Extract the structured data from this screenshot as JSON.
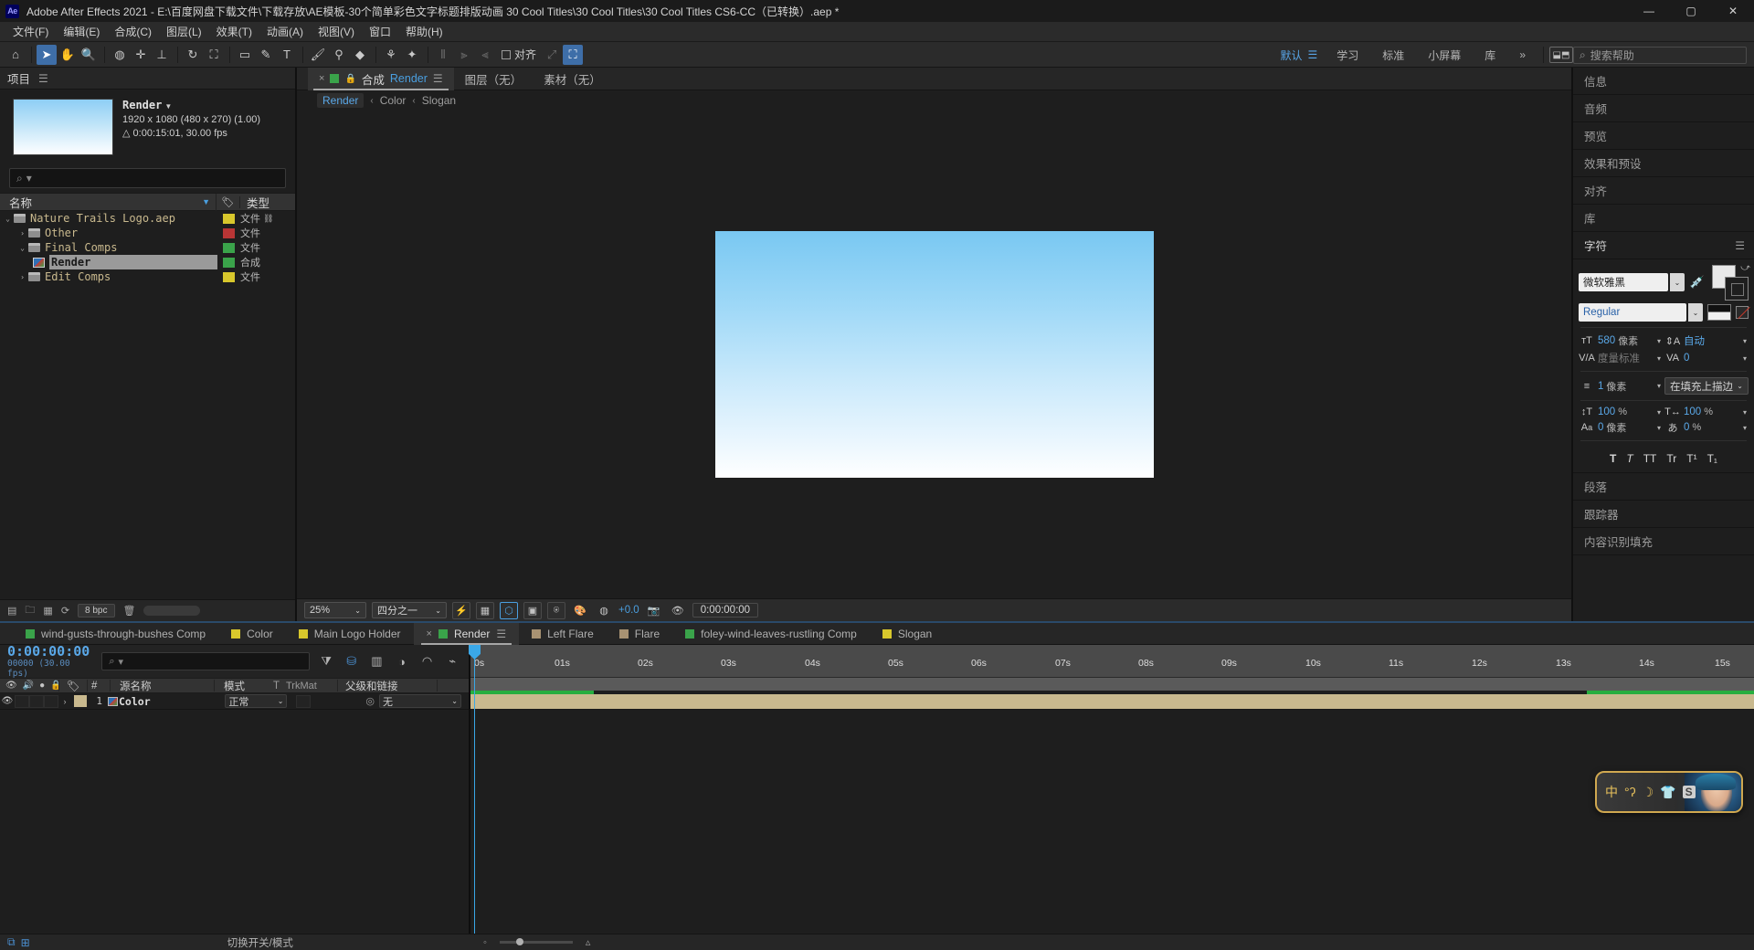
{
  "titlebar": {
    "app_icon": "Ae",
    "title": "Adobe After Effects 2021 - E:\\百度网盘下载文件\\下载存放\\AE模板-30个简单彩色文字标题排版动画 30 Cool Titles\\30 Cool Titles\\30 Cool Titles CS6-CC（已转换）.aep *",
    "minimize": "—",
    "maximize": "▢",
    "close": "✕"
  },
  "menubar": {
    "items": [
      "文件(F)",
      "编辑(E)",
      "合成(C)",
      "图层(L)",
      "效果(T)",
      "动画(A)",
      "视图(V)",
      "窗口",
      "帮助(H)"
    ]
  },
  "toolbar": {
    "align_label": "对齐",
    "workspaces": [
      "默认",
      "学习",
      "标准",
      "小屏幕",
      "库"
    ],
    "workspace_active": "默认",
    "overflow": "»",
    "search_placeholder": "搜索帮助"
  },
  "project": {
    "tab_label": "项目",
    "item_name": "Render",
    "item_dimensions": "1920 x 1080  (480 x 270) (1.00)",
    "item_duration": "0:00:15:01, 30.00 fps",
    "search_placeholder": "",
    "columns": {
      "name": "名称",
      "type": "类型"
    },
    "tree": [
      {
        "label": "Nature Trails Logo.aep",
        "type": "文件",
        "swatch": "#d8c72c",
        "indent": 0,
        "twist": "open",
        "icon": "folder",
        "selected": false,
        "has_extra": true
      },
      {
        "label": "Other",
        "type": "文件",
        "swatch": "#b83535",
        "indent": 1,
        "twist": "closed",
        "icon": "folder",
        "selected": false,
        "has_extra": false
      },
      {
        "label": "Final Comps",
        "type": "文件",
        "swatch": "#3aa34a",
        "indent": 1,
        "twist": "open",
        "icon": "folder",
        "selected": false,
        "has_extra": false
      },
      {
        "label": "Render",
        "type": "合成",
        "swatch": "#3aa34a",
        "indent": 2,
        "twist": "none",
        "icon": "comp",
        "selected": true,
        "has_extra": false
      },
      {
        "label": "Edit Comps",
        "type": "文件",
        "swatch": "#d8c72c",
        "indent": 1,
        "twist": "closed",
        "icon": "folder",
        "selected": false,
        "has_extra": false
      }
    ],
    "footer": {
      "bpc": "8 bpc"
    }
  },
  "comp": {
    "tab_comp_label": "合成",
    "tab_comp_name": "Render",
    "tab_layer": "图层（无）",
    "tab_footage": "素材（无）",
    "breadcrumb": [
      "Render",
      "Color",
      "Slogan"
    ],
    "breadcrumb_sep": "‹",
    "toolbar": {
      "zoom": "25%",
      "resolution": "四分之一",
      "exposure": "+0.0",
      "timecode": "0:00:00:00"
    }
  },
  "right_panel": {
    "tabs": [
      "信息",
      "音频",
      "预览",
      "效果和预设",
      "对齐",
      "库"
    ],
    "character": {
      "title": "字符",
      "font_family": "微软雅黑",
      "font_style": "Regular",
      "font_size": "580",
      "font_size_unit": "像素",
      "leading": "自动",
      "kerning": "度量标准",
      "tracking": "0",
      "stroke_width": "1",
      "stroke_width_unit": "像素",
      "stroke_mode": "在填充上描边",
      "vertical_scale": "100",
      "vertical_scale_unit": "%",
      "horizontal_scale": "100",
      "horizontal_scale_unit": "%",
      "baseline_shift": "0",
      "baseline_shift_unit": "像素",
      "tsume": "0",
      "tsume_unit": "%",
      "styles": [
        "T",
        "T",
        "TT",
        "Tr",
        "T¹",
        "T₁"
      ]
    },
    "bottom_tabs": [
      "段落",
      "跟踪器",
      "内容识别填充"
    ]
  },
  "timeline": {
    "tabs": [
      {
        "label": "wind-gusts-through-bushes Comp",
        "color": "#3aa34a",
        "active": false
      },
      {
        "label": "Color",
        "color": "#d8c72c",
        "active": false
      },
      {
        "label": "Main Logo Holder",
        "color": "#d8c72c",
        "active": false
      },
      {
        "label": "Render",
        "color": "#3aa34a",
        "active": true
      },
      {
        "label": "Left Flare",
        "color": "#a89272",
        "active": false
      },
      {
        "label": "Flare",
        "color": "#a89272",
        "active": false
      },
      {
        "label": "foley-wind-leaves-rustling Comp",
        "color": "#3aa34a",
        "active": false
      },
      {
        "label": "Slogan",
        "color": "#d8c72c",
        "active": false
      }
    ],
    "current_time": "0:00:00:00",
    "frame_info": "00000 (30.00 fps)",
    "search_placeholder": "",
    "columns": {
      "source_name": "源名称",
      "mode": "模式",
      "t": "T",
      "trkmat": "TrkMat",
      "parent": "父级和链接"
    },
    "layers": [
      {
        "index": "1",
        "name": "Color",
        "mode": "正常",
        "parent": "无",
        "color": "#c9b98e"
      }
    ],
    "ruler_ticks": [
      "0s",
      "01s",
      "02s",
      "03s",
      "04s",
      "05s",
      "06s",
      "07s",
      "08s",
      "09s",
      "10s",
      "11s",
      "12s",
      "13s",
      "14s",
      "15s"
    ],
    "footer": {
      "switches_label": "切换开关/模式"
    }
  },
  "ime_widget": {
    "mode": "中",
    "punctuation": "°ʔ",
    "moon": "☽",
    "shirt": "👕",
    "badge": "S"
  }
}
